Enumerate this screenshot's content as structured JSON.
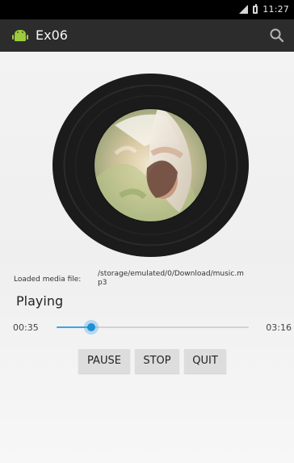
{
  "status_bar": {
    "time": "11:27"
  },
  "action_bar": {
    "title": "Ex06"
  },
  "media": {
    "loaded_label": "Loaded media file:",
    "file_path": "/storage/emulated/0/Download/music.mp3",
    "state": "Playing",
    "current_time": "00:35",
    "total_time": "03:16",
    "progress_fraction": 0.18
  },
  "controls": {
    "pause_label": "PAUSE",
    "stop_label": "STOP",
    "quit_label": "QUIT"
  },
  "colors": {
    "action_bar": "#2c2c2c",
    "accent": "#1f8ed7",
    "disc": "#1b1b1b",
    "button": "#dddddd"
  }
}
